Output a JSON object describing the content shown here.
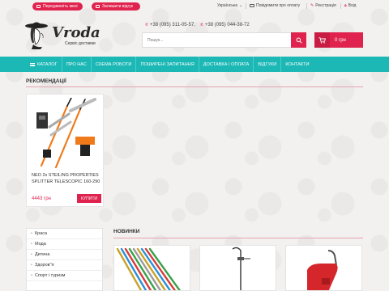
{
  "topbar": {
    "callback_label": "Передзвоніть мені",
    "feedback_label": "Залишити відгук",
    "language": "Українська",
    "notify_label": "Повідомити про оплату",
    "register_label": "Реєстрація",
    "login_label": "Вхід"
  },
  "logo": {
    "name": "Vroda",
    "tagline": "Сервіс доставки"
  },
  "phones": [
    "+38 (095) 311-05-57,",
    "+38 (095) 044-38-72"
  ],
  "search": {
    "placeholder": "Пошук..."
  },
  "cart": {
    "label": "0 грн"
  },
  "nav": {
    "items": [
      "КАТАЛОГ",
      "ПРО НАС",
      "СХЕМА РОБОТИ",
      "ПОШИРЕНІ ЗАПИТАННЯ",
      "ДОСТАВКА І ОПЛАТА",
      "ВІДГУКИ",
      "КОНТАКТИ"
    ]
  },
  "recommend": {
    "title": "РЕКОМЕНДАЦІЇ",
    "product": {
      "name": "NEO 2x STEILING PROPERTIES SPLITTER TELESCOPIC 160-290",
      "price": "4443 грн",
      "buy_label": "КУПИТИ"
    }
  },
  "categories": [
    "Краса",
    "Мода",
    "Дитина",
    "Здоров\"я",
    "Спорт і туризм"
  ],
  "new_section": {
    "title": "НОВИНКИ"
  },
  "colors": {
    "accent": "#e0234e",
    "nav": "#1bb8b6"
  }
}
